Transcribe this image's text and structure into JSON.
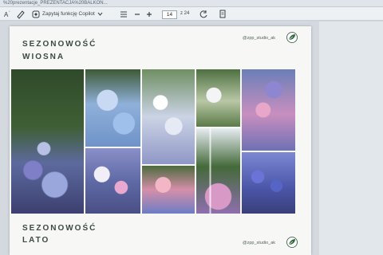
{
  "addressbar": {
    "path_text": "%20prezentacje_PREZENTACJA%20BALKON..."
  },
  "toolbar": {
    "copilot_label": "Zapytaj funkcję Copilot",
    "page_number": "14",
    "page_total": "z 24"
  },
  "slide": {
    "heading_spring_line1": "SEZONOWOŚĆ",
    "heading_spring_line2": "WIOSNA",
    "heading_summer_line1": "SEZONOWOŚĆ",
    "heading_summer_line2": "LATO",
    "handle": "@zpp_studio_ak"
  },
  "colors": {
    "heading": "#3b4a44",
    "slide_bg": "#f7f8f6",
    "toolbar_bg": "#eef1f4"
  },
  "icons": [
    "text-cursor-icon",
    "draw-icon",
    "copilot-icon",
    "chevron-down-icon",
    "menu-icon",
    "minus-icon",
    "plus-icon",
    "fit-page-icon",
    "rotate-icon",
    "page-view-icon",
    "logo-icon"
  ]
}
